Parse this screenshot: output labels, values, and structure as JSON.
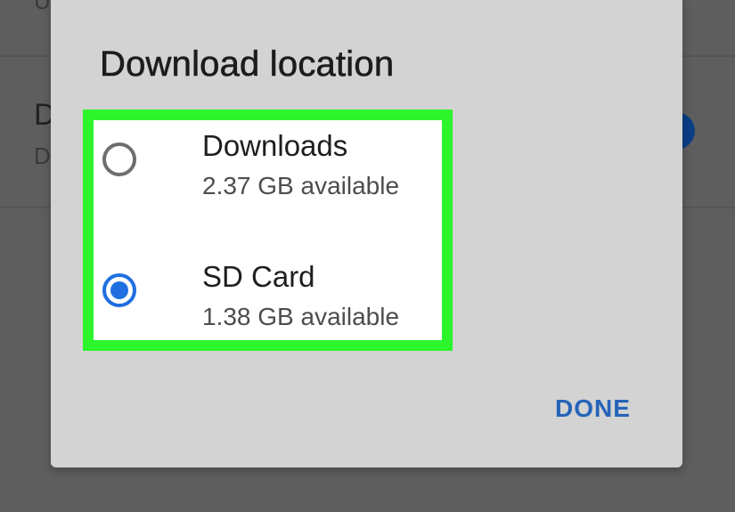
{
  "dialog": {
    "title": "Download location",
    "options": [
      {
        "label": "Downloads",
        "available": "2.37 GB available",
        "selected": false
      },
      {
        "label": "SD Card",
        "available": "1.38 GB available",
        "selected": true
      }
    ],
    "done_label": "DONE"
  },
  "background": {
    "item_letter": "D",
    "sub_letter": "D",
    "top_letter": "U"
  },
  "colors": {
    "highlight": "#2cf52c",
    "accent": "#1f6fe0",
    "done": "#2563b8",
    "dialog_bg": "#d3d3d3"
  }
}
